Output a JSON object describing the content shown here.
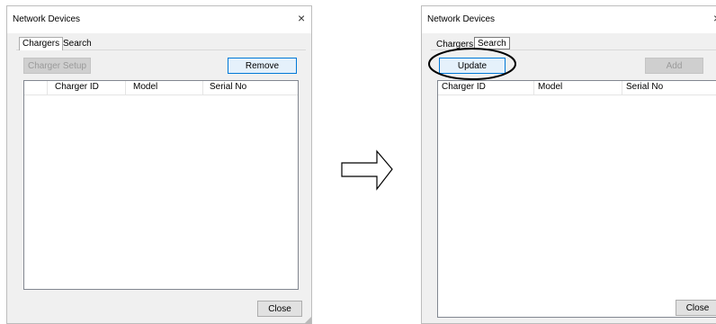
{
  "left_dialog": {
    "title": "Network Devices",
    "close_glyph": "×",
    "tabs": [
      {
        "label": "Chargers",
        "active": true
      },
      {
        "label": "Search",
        "active": false
      }
    ],
    "charger_setup_label": "Charger Setup",
    "remove_label": "Remove",
    "columns": [
      "",
      "Charger ID",
      "Model",
      "Serial No"
    ],
    "rows": [],
    "close_label": "Close"
  },
  "right_dialog": {
    "title": "Network Devices",
    "close_glyph": "×",
    "tabs": [
      {
        "label": "Chargers",
        "active": false
      },
      {
        "label": "Search",
        "active": true
      }
    ],
    "update_label": "Update",
    "add_label": "Add",
    "columns": [
      "Charger ID",
      "Model",
      "Serial No"
    ],
    "rows": [],
    "close_label": "Close"
  },
  "transition": {
    "icon": "right-arrow-icon"
  },
  "annotation": {
    "icon": "highlight-ellipse-icon",
    "target": "update_button"
  },
  "colors": {
    "dialog_bg": "#f0f0f0",
    "accent_border": "#0078d7",
    "accent_fill": "#e5f1fb",
    "disabled_fill": "#cfcfcf"
  }
}
